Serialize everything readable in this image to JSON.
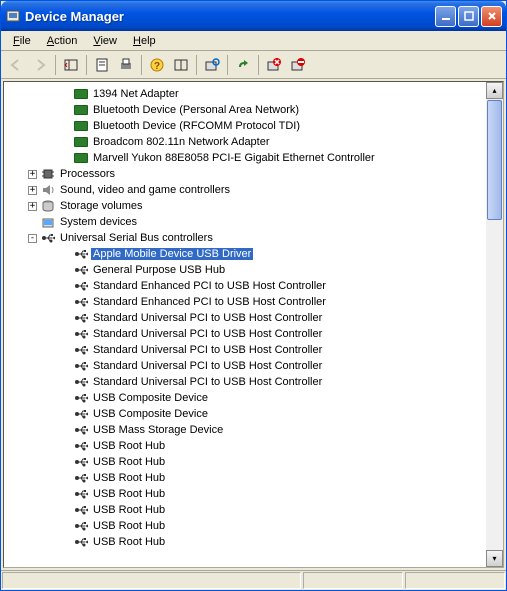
{
  "window": {
    "title": "Device Manager"
  },
  "menu": {
    "file": "File",
    "action": "Action",
    "view": "View",
    "help": "Help"
  },
  "tree": {
    "net_items": [
      "1394 Net Adapter",
      "Bluetooth Device (Personal Area Network)",
      "Bluetooth Device (RFCOMM Protocol TDI)",
      "Broadcom 802.11n Network Adapter",
      "Marvell Yukon 88E8058 PCI-E Gigabit Ethernet Controller"
    ],
    "categories": [
      {
        "label": "Processors",
        "expander": "+",
        "icon": "proc"
      },
      {
        "label": "Sound, video and game controllers",
        "expander": "+",
        "icon": "snd"
      },
      {
        "label": "Storage volumes",
        "expander": "+",
        "icon": "vol"
      },
      {
        "label": "System devices",
        "expander": "",
        "icon": "sys"
      },
      {
        "label": "Universal Serial Bus controllers",
        "expander": "-",
        "icon": "usb"
      }
    ],
    "usb_items": [
      {
        "label": "Apple Mobile Device USB Driver",
        "selected": true
      },
      {
        "label": "General Purpose USB Hub",
        "selected": false
      },
      {
        "label": "Standard Enhanced PCI to USB Host Controller",
        "selected": false
      },
      {
        "label": "Standard Enhanced PCI to USB Host Controller",
        "selected": false
      },
      {
        "label": "Standard Universal PCI to USB Host Controller",
        "selected": false
      },
      {
        "label": "Standard Universal PCI to USB Host Controller",
        "selected": false
      },
      {
        "label": "Standard Universal PCI to USB Host Controller",
        "selected": false
      },
      {
        "label": "Standard Universal PCI to USB Host Controller",
        "selected": false
      },
      {
        "label": "Standard Universal PCI to USB Host Controller",
        "selected": false
      },
      {
        "label": "USB Composite Device",
        "selected": false
      },
      {
        "label": "USB Composite Device",
        "selected": false
      },
      {
        "label": "USB Mass Storage Device",
        "selected": false
      },
      {
        "label": "USB Root Hub",
        "selected": false
      },
      {
        "label": "USB Root Hub",
        "selected": false
      },
      {
        "label": "USB Root Hub",
        "selected": false
      },
      {
        "label": "USB Root Hub",
        "selected": false
      },
      {
        "label": "USB Root Hub",
        "selected": false
      },
      {
        "label": "USB Root Hub",
        "selected": false
      },
      {
        "label": "USB Root Hub",
        "selected": false
      }
    ]
  }
}
